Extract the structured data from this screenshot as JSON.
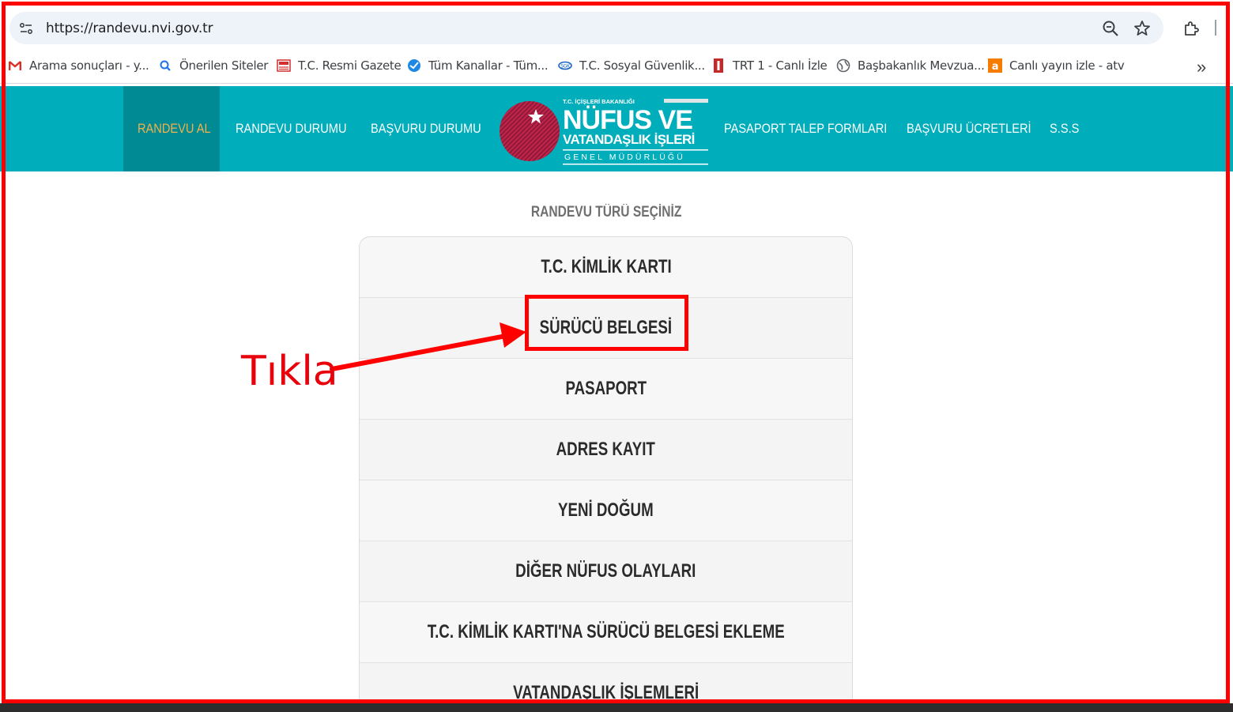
{
  "browser": {
    "url": "https://randevu.nvi.gov.tr",
    "bookmarks": [
      {
        "label": "Arama sonuçları - y...",
        "icon": "gmail-icon"
      },
      {
        "label": "Önerilen Siteler",
        "icon": "search-icon"
      },
      {
        "label": "T.C. Resmi Gazete",
        "icon": "gazette-icon"
      },
      {
        "label": "Tüm Kanallar - Tüm...",
        "icon": "globe-blue-icon"
      },
      {
        "label": "T.C. Sosyal Güvenlik...",
        "icon": "sgk-icon"
      },
      {
        "label": "TRT 1 - Canlı İzle",
        "icon": "trt1-icon"
      },
      {
        "label": "Başbakanlık Mevzua...",
        "icon": "globe-icon"
      },
      {
        "label": "Canlı yayın izle - atv",
        "icon": "atv-icon"
      }
    ],
    "more_bookmarks": "»"
  },
  "site": {
    "nav_left": [
      "RANDEVU AL",
      "RANDEVU DURUMU",
      "BAŞVURU DURUMU"
    ],
    "nav_right": [
      "PASAPORT TALEP FORMLARI",
      "BAŞVURU ÜCRETLERİ",
      "S.S.S"
    ],
    "logo": {
      "top": "T.C. İÇİŞLERİ BAKANLIĞI",
      "line1": "NÜFUS VE",
      "line2": "VATANDAŞLIK İŞLERİ",
      "line3": "GENEL MÜDÜRLÜĞÜ"
    },
    "colors": {
      "header": "#00adbb",
      "active_nav_bg": "#008a93",
      "active_nav_text": "#f3b24c"
    }
  },
  "content": {
    "title": "RANDEVU TÜRÜ SEÇİNİZ",
    "options": [
      "T.C. KİMLİK KARTI",
      "SÜRÜCÜ BELGESİ",
      "PASAPORT",
      "ADRES KAYIT",
      "YENİ DOĞUM",
      "DİĞER NÜFUS OLAYLARI",
      "T.C. KİMLİK KARTI'NA SÜRÜCÜ BELGESİ EKLEME",
      "VATANDAŞLIK İŞLEMLERİ"
    ]
  },
  "annotation": {
    "text": "Tıkla",
    "color": "#ff0000"
  }
}
